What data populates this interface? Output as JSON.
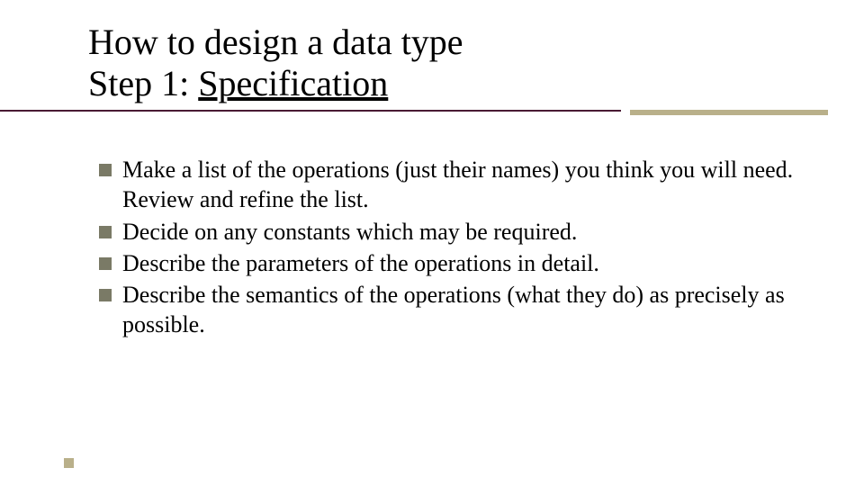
{
  "title": {
    "line1": "How to design a data type",
    "step_label": "Step 1: ",
    "step_name": "Specification"
  },
  "bullets": [
    "Make a list of the operations (just their names) you think you will need. Review and refine the list.",
    "Decide on any constants which may be required.",
    "Describe the parameters of the operations in detail.",
    "Describe the semantics of the operations (what they do) as precisely as possible."
  ]
}
